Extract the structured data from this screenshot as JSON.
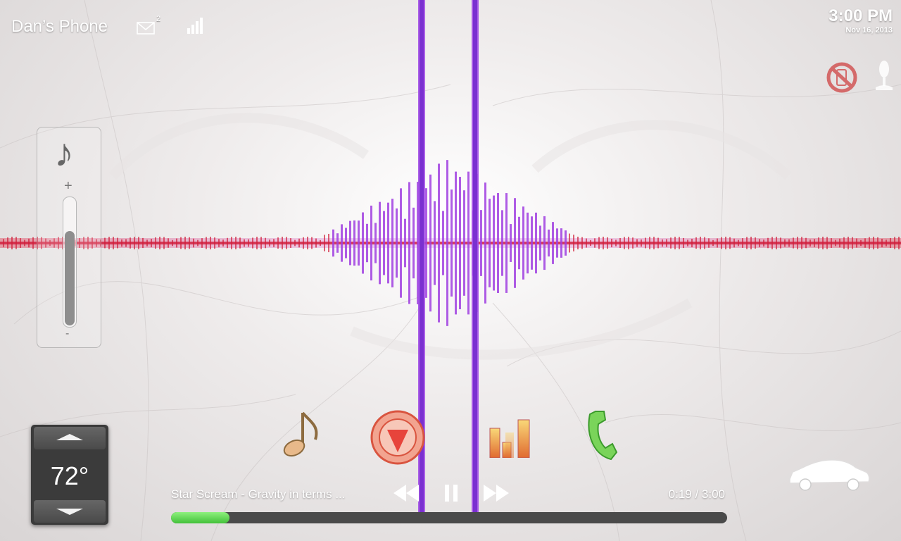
{
  "status_bar": {
    "phone_name": "Dan’s Phone",
    "message_count": "2",
    "time": "3:00 PM",
    "date": "Nov 16, 2013"
  },
  "icons": {
    "mail": "mail-icon",
    "signal": "signal-bars-icon",
    "no_phone": "no-phone-icon",
    "mic": "microphone-icon",
    "music_note": "music-note-icon",
    "navigation": "navigation-arrow-icon",
    "equalizer": "equalizer-icon",
    "phone": "phone-handset-icon",
    "car": "car-icon"
  },
  "volume": {
    "plus_label": "+",
    "minus_label": "-",
    "level": 0.73
  },
  "climate": {
    "temperature": "72°"
  },
  "player": {
    "track_title": "Star Scream - Gravity in terms ...",
    "time_readout": "0:19 / 3:00",
    "progress_fraction": 0.105,
    "controls": [
      "rewind",
      "pause",
      "fast-forward"
    ]
  },
  "colors": {
    "waveform_center": "#a040e0",
    "waveform_outer": "#d0203a",
    "progress": "#5ad14c"
  }
}
